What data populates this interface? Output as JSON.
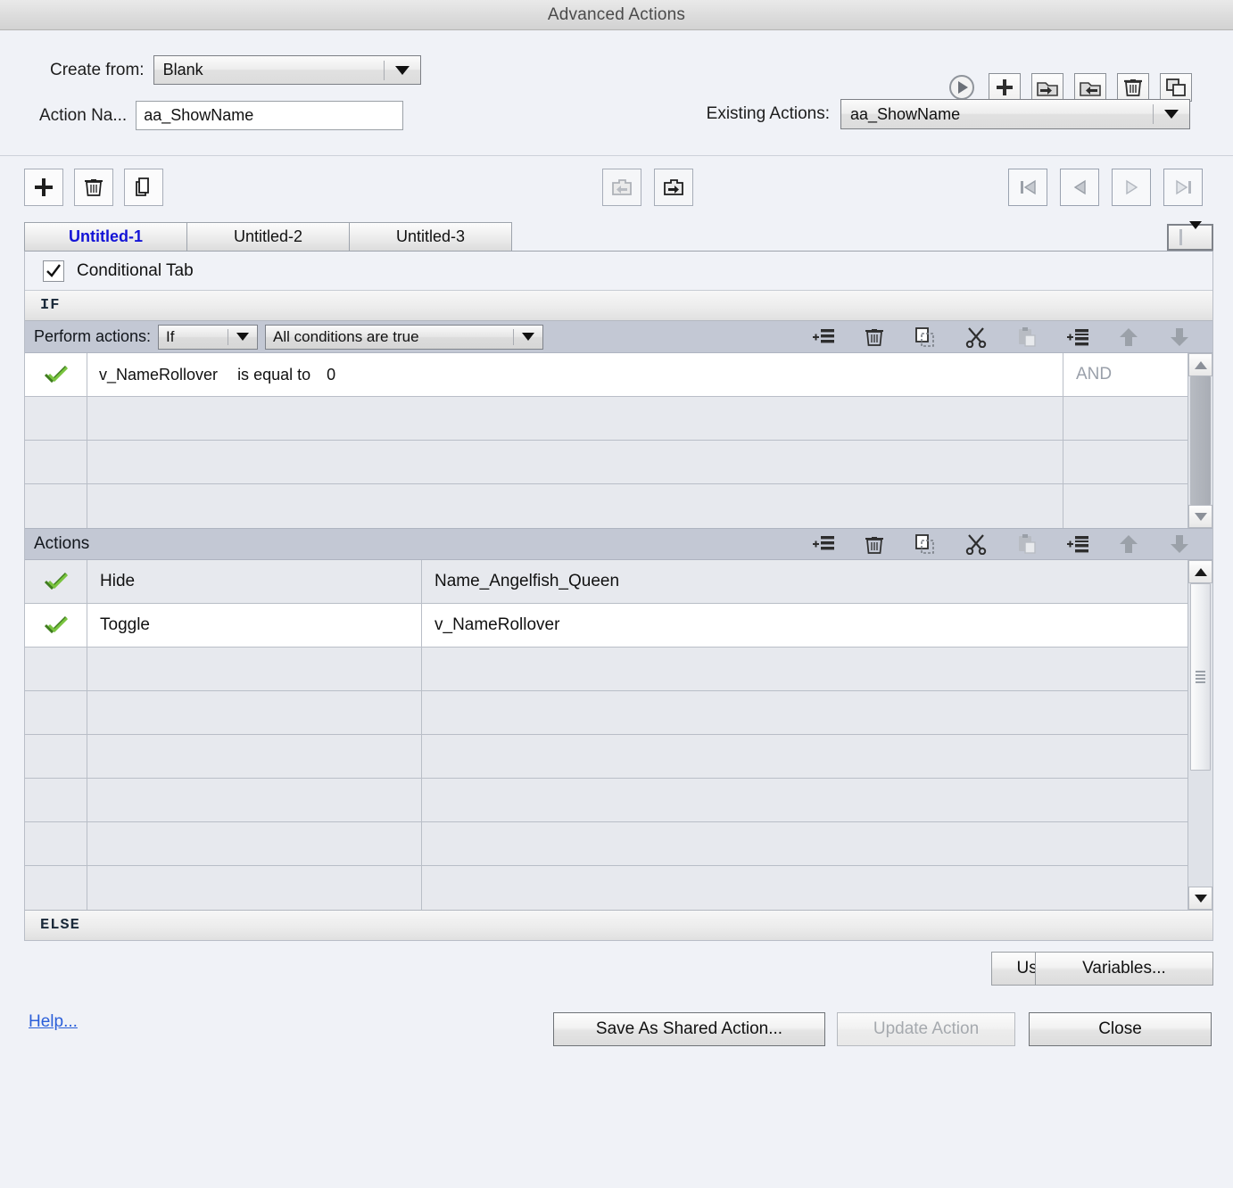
{
  "window": {
    "title": "Advanced Actions"
  },
  "form": {
    "create_from_label": "Create from:",
    "create_from_value": "Blank",
    "action_name_label": "Action Na...",
    "action_name_value": "aa_ShowName",
    "existing_actions_label": "Existing Actions:",
    "existing_actions_value": "aa_ShowName"
  },
  "top_toolbar": [
    {
      "name": "preview-play-icon",
      "title": "Preview"
    },
    {
      "name": "add-icon",
      "title": "Add"
    },
    {
      "name": "export-action-icon",
      "title": "Export"
    },
    {
      "name": "import-action-icon",
      "title": "Import"
    },
    {
      "name": "delete-icon",
      "title": "Delete"
    },
    {
      "name": "duplicate-icon",
      "title": "Duplicate"
    }
  ],
  "tab_toolbar": {
    "left": [
      {
        "name": "add-tab-icon",
        "title": "Add tab"
      },
      {
        "name": "delete-tab-icon",
        "title": "Delete tab"
      },
      {
        "name": "duplicate-tab-icon",
        "title": "Duplicate tab"
      }
    ],
    "middle": [
      {
        "name": "import-tab-icon",
        "title": "Import",
        "disabled": true
      },
      {
        "name": "export-tab-icon",
        "title": "Export",
        "disabled": false
      }
    ],
    "right": [
      {
        "name": "first-tab-icon",
        "title": "First",
        "disabled": true
      },
      {
        "name": "previous-tab-icon",
        "title": "Previous",
        "disabled": true
      },
      {
        "name": "next-tab-icon",
        "title": "Next",
        "disabled": true
      },
      {
        "name": "last-tab-icon",
        "title": "Last",
        "disabled": true
      }
    ]
  },
  "tabs": [
    {
      "label": "Untitled-1",
      "active": true
    },
    {
      "label": "Untitled-2",
      "active": false
    },
    {
      "label": "Untitled-3",
      "active": false
    }
  ],
  "conditional_tab": {
    "label": "Conditional Tab",
    "checked": true
  },
  "if_label": "IF",
  "else_label": "ELSE",
  "condition_header": {
    "perform_label": "Perform actions:",
    "operator_value": "If",
    "mode_value": "All conditions are true"
  },
  "row_icons": [
    {
      "name": "add-row-icon"
    },
    {
      "name": "delete-row-icon"
    },
    {
      "name": "copy-row-icon"
    },
    {
      "name": "cut-row-icon"
    },
    {
      "name": "paste-row-icon"
    },
    {
      "name": "insert-row-icon"
    },
    {
      "name": "move-up-icon"
    },
    {
      "name": "move-down-icon"
    }
  ],
  "conditions": {
    "rows": [
      {
        "enabled": true,
        "variable": "v_NameRollover",
        "operator": "is equal to",
        "value": "0",
        "conjunction": "AND"
      }
    ],
    "empty_row_count": 3
  },
  "actions_header": {
    "label": "Actions"
  },
  "actions": {
    "rows": [
      {
        "enabled": true,
        "action": "Hide",
        "target": "Name_Angelfish_Queen"
      },
      {
        "enabled": true,
        "action": "Toggle",
        "target": "v_NameRollover"
      }
    ],
    "empty_row_count": 8
  },
  "footer": {
    "usage_label": "Usage",
    "variables_label": "Variables...",
    "help_label": "Help...",
    "save_as_shared_label": "Save As Shared Action...",
    "update_action_label": "Update Action",
    "update_action_disabled": true,
    "close_label": "Close"
  },
  "colors": {
    "accent_blue": "#1414d6",
    "link_blue": "#2b5fd9",
    "check_green": "#5ba12e",
    "header_gray": "#c3c8d4",
    "panel_bg": "#f0f2f7"
  }
}
